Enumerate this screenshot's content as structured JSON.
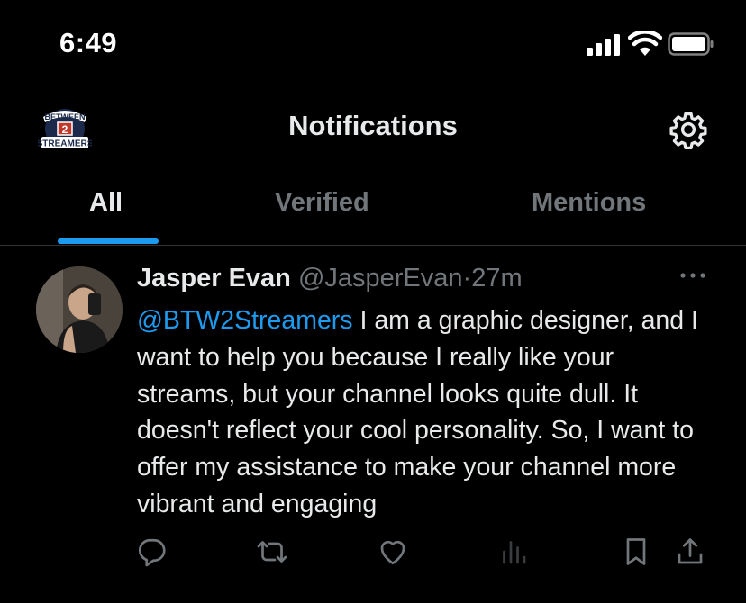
{
  "status_bar": {
    "time": "6:49",
    "icons": [
      "signal-icon",
      "wifi-icon",
      "battery-icon"
    ]
  },
  "header": {
    "title": "Notifications",
    "logo_lines": [
      "BETWEEN",
      "2",
      "STREAMERS"
    ],
    "settings_icon": "gear-icon"
  },
  "tabs": [
    {
      "label": "All",
      "active": true
    },
    {
      "label": "Verified",
      "active": false
    },
    {
      "label": "Mentions",
      "active": false
    }
  ],
  "tweet": {
    "display_name": "Jasper Evan",
    "handle": "@JasperEvan",
    "separator": "·",
    "time": "27m",
    "mention": "@BTW2Streamers",
    "text": " I am a graphic designer, and I want to help you because I really like your streams, but your channel looks quite dull. It doesn't reflect your cool personality. So, I want to offer my assistance to make your channel more vibrant and engaging",
    "actions": [
      "reply-icon",
      "retweet-icon",
      "like-icon",
      "views-icon",
      "bookmark-icon",
      "share-icon"
    ]
  },
  "colors": {
    "accent": "#1d9bf0",
    "text": "#e7e9ea",
    "muted": "#71767b",
    "background": "#000000",
    "divider": "#2f3336"
  }
}
